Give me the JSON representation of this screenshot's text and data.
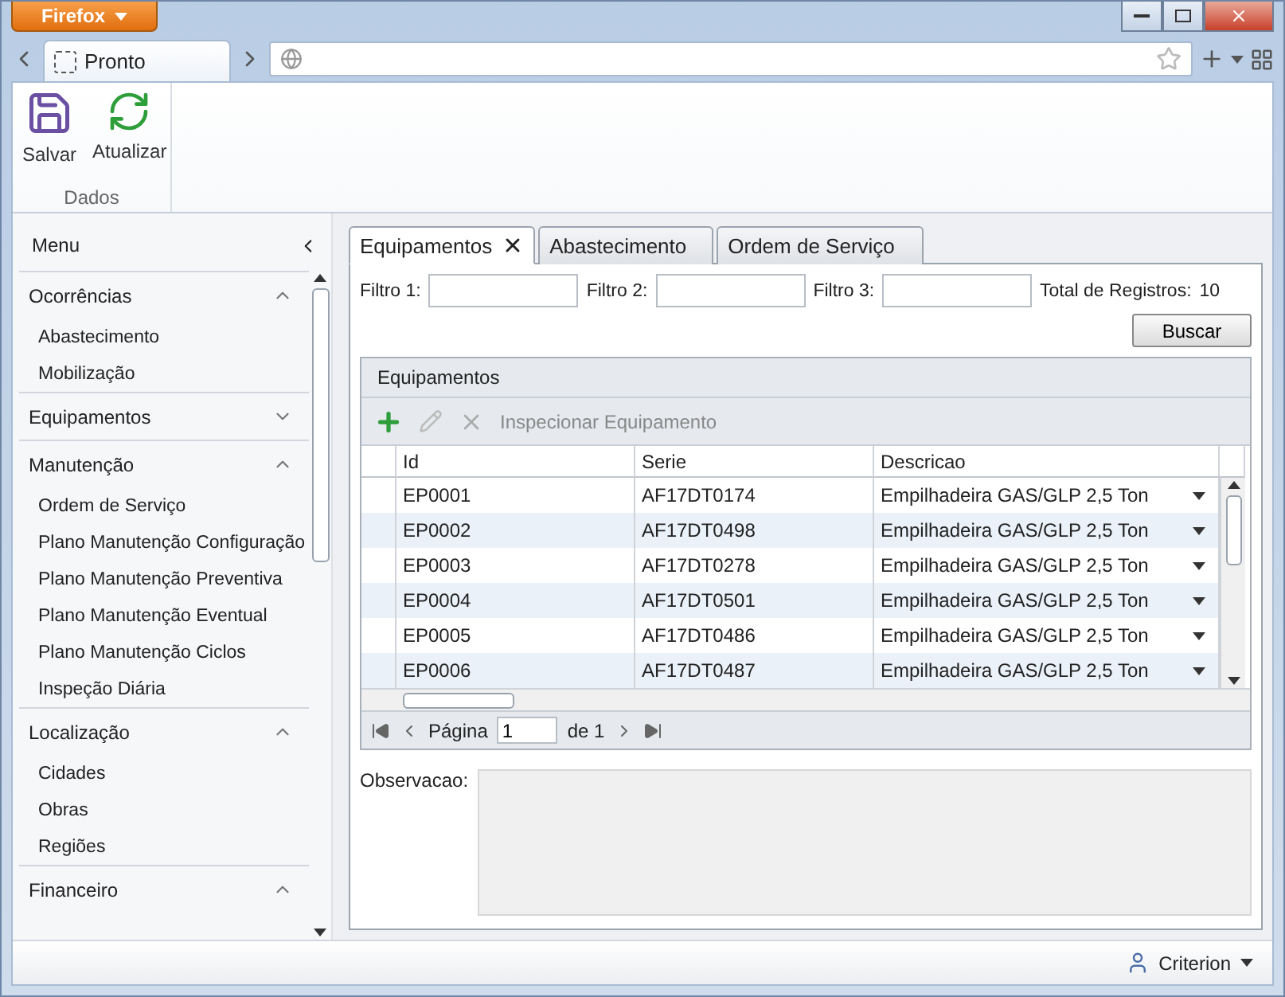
{
  "browser": {
    "menu_button": "Firefox",
    "tab": "Pronto"
  },
  "ribbon": {
    "buttons": [
      {
        "label": "Salvar",
        "kind": "save"
      },
      {
        "label": "Atualizar",
        "kind": "refresh"
      }
    ],
    "group": "Dados"
  },
  "sidebar": {
    "title": "Menu",
    "sections": [
      {
        "label": "Ocorrências",
        "expanded": true,
        "children": [
          {
            "label": "Abastecimento"
          },
          {
            "label": "Mobilização"
          }
        ]
      },
      {
        "label": "Equipamentos",
        "expanded": false
      },
      {
        "label": "Manutenção",
        "expanded": true,
        "children": [
          {
            "label": "Ordem de Serviço"
          },
          {
            "label": "Plano Manutenção Configuração"
          },
          {
            "label": "Plano Manutenção Preventiva"
          },
          {
            "label": "Plano Manutenção Eventual"
          },
          {
            "label": "Plano Manutenção Ciclos"
          },
          {
            "label": "Inspeção Diária"
          }
        ]
      },
      {
        "label": "Localização",
        "expanded": true,
        "children": [
          {
            "label": "Cidades"
          },
          {
            "label": "Obras"
          },
          {
            "label": "Regiões"
          }
        ]
      },
      {
        "label": "Financeiro",
        "expanded": true
      }
    ]
  },
  "tabs": [
    {
      "label": "Equipamentos",
      "selected": true,
      "closable": true
    },
    {
      "label": "Abastecimento",
      "selected": false,
      "closable": false
    },
    {
      "label": "Ordem de Serviço",
      "selected": false,
      "closable": false
    }
  ],
  "filters": [
    {
      "label": "Filtro 1:"
    },
    {
      "label": "Filtro 2:"
    },
    {
      "label": "Filtro 3:"
    }
  ],
  "total": {
    "label": "Total de Registros:",
    "value": "10"
  },
  "search_button": "Buscar",
  "grid": {
    "title": "Equipamentos",
    "action": "Inspecionar Equipamento",
    "columns": [
      "Id",
      "Serie",
      "Descricao"
    ],
    "rows": [
      [
        "EP0001",
        "AF17DT0174",
        "Empilhadeira GAS/GLP 2,5 Ton"
      ],
      [
        "EP0002",
        "AF17DT0498",
        "Empilhadeira GAS/GLP 2,5 Ton"
      ],
      [
        "EP0003",
        "AF17DT0278",
        "Empilhadeira GAS/GLP 2,5 Ton"
      ],
      [
        "EP0004",
        "AF17DT0501",
        "Empilhadeira GAS/GLP 2,5 Ton"
      ],
      [
        "EP0005",
        "AF17DT0486",
        "Empilhadeira GAS/GLP 2,5 Ton"
      ],
      [
        "EP0006",
        "AF17DT0487",
        "Empilhadeira GAS/GLP 2,5 Ton"
      ]
    ],
    "pager": {
      "label": "Página",
      "value": "1",
      "of": "de 1"
    }
  },
  "observation": {
    "label": "Observacao:"
  },
  "status": {
    "user": "Criterion"
  }
}
